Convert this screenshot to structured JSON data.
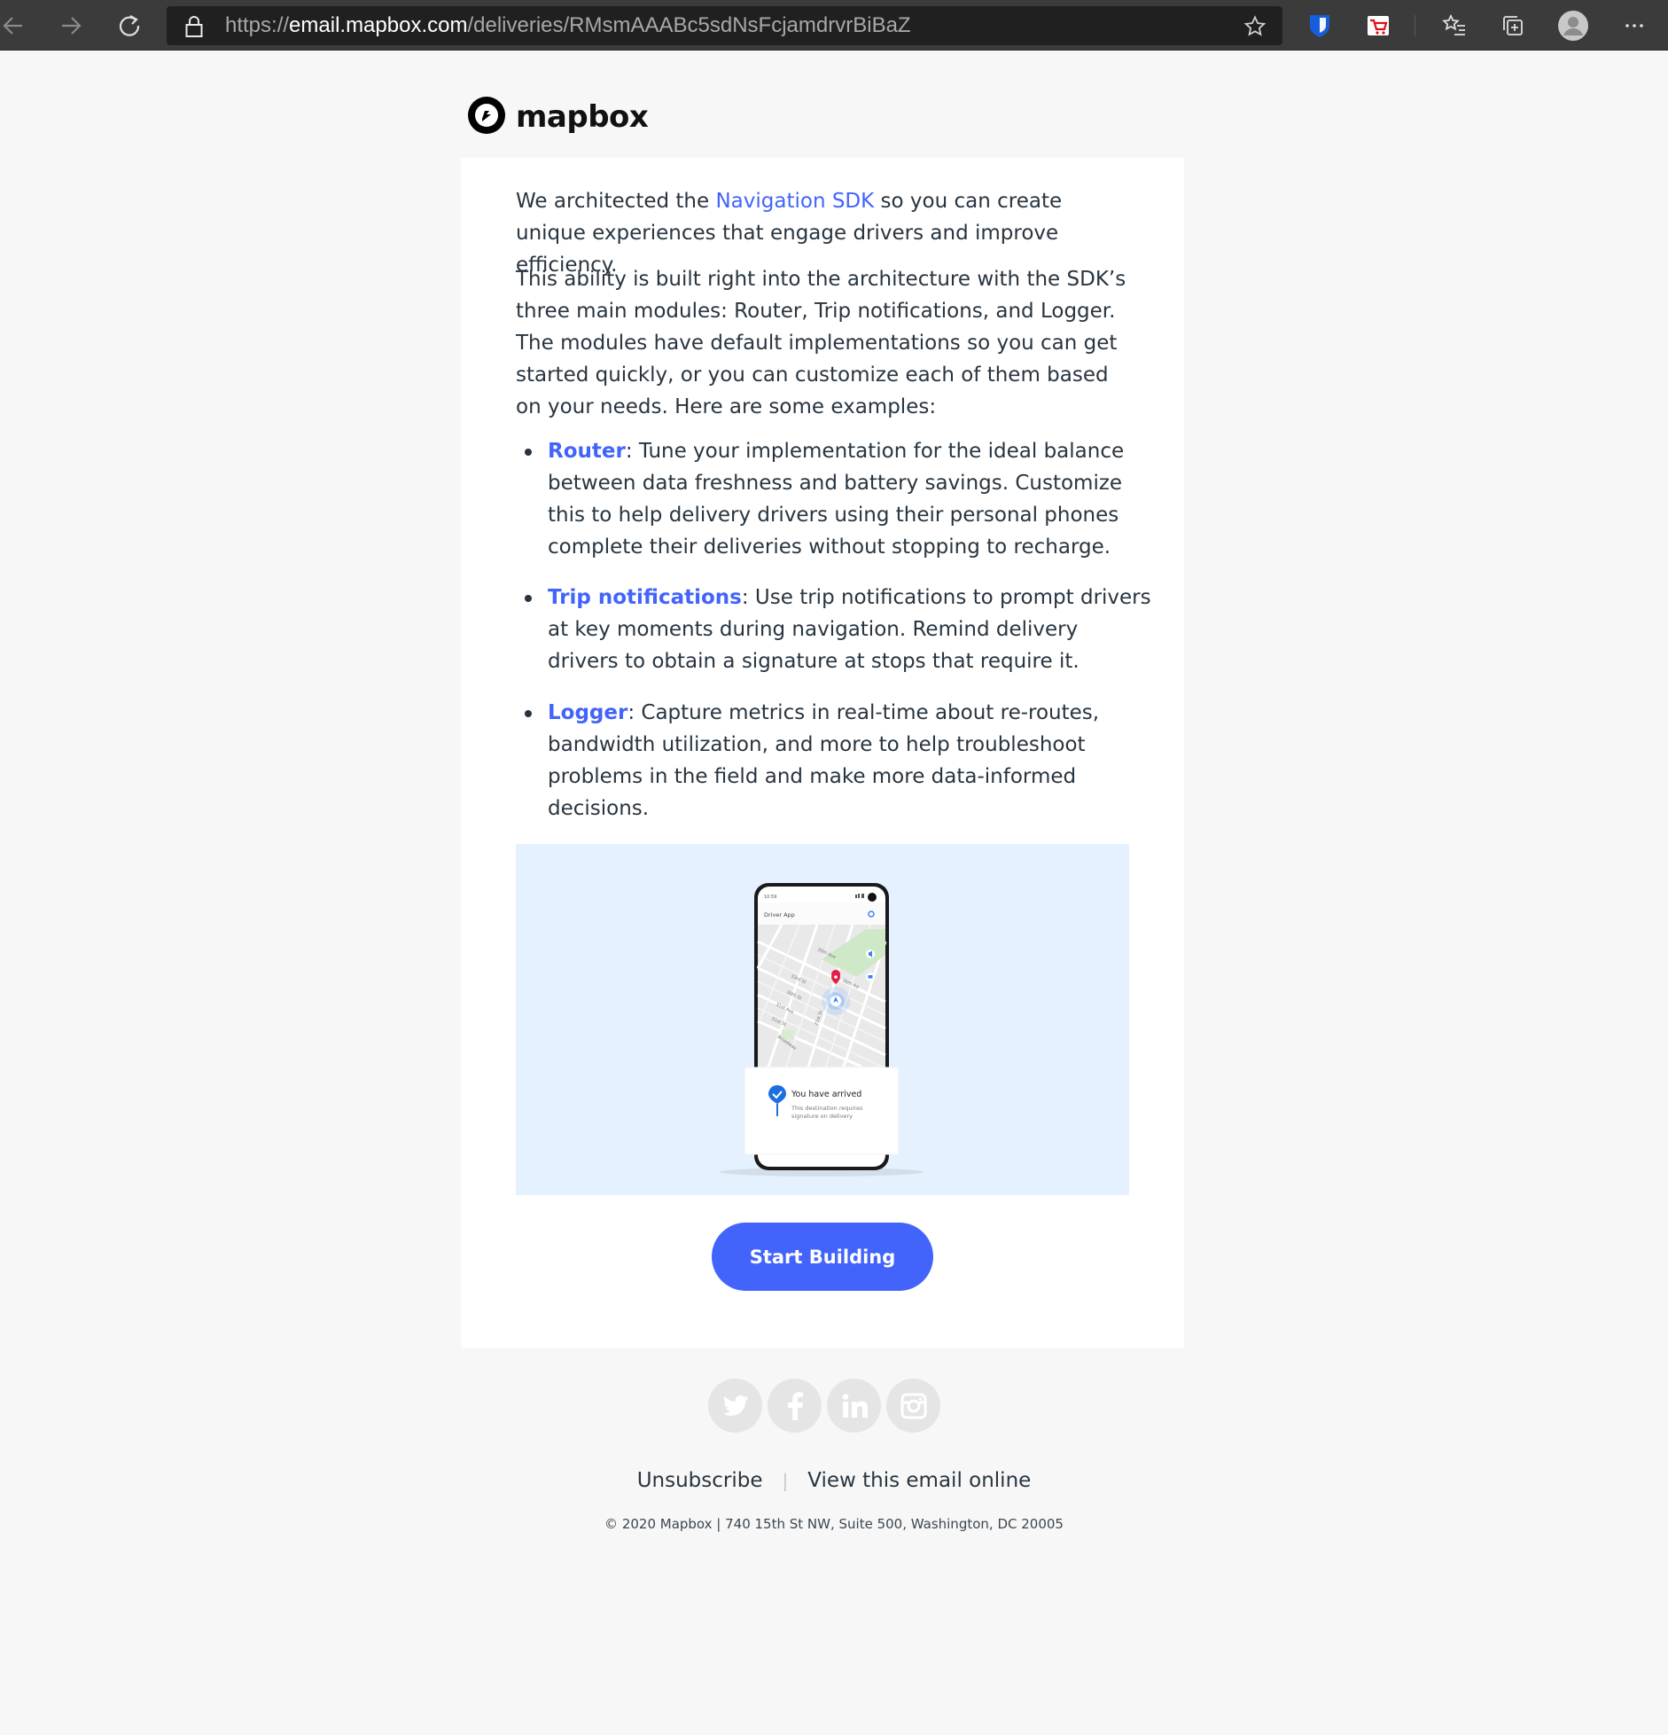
{
  "browser": {
    "url_protocol": "https://",
    "url_host": "email.mapbox.com",
    "url_path": "/deliveries/RMsmAAABc5sdNsFcjamdrvrBiBaZ",
    "icons": [
      "back-arrow-icon",
      "forward-arrow-icon",
      "refresh-icon",
      "lock-icon",
      "favorite-star-icon",
      "bitwarden-shield-icon",
      "extension-icon",
      "favorites-list-icon",
      "collections-icon",
      "profile-avatar-icon",
      "more-menu-icon"
    ]
  },
  "email": {
    "brand_name": "mapbox",
    "intro_before_link": "We architected the ",
    "intro_link": "Navigation SDK",
    "intro_after_link": " so you can create unique experiences that engage drivers and improve efficiency.",
    "paragraph2": "This ability is built right into the architecture with the SDK’s three main modules: Router, Trip notifications, and Logger. The modules have default implementations so you can get started quickly, or you can customize each of them based on your needs. Here are some examples:",
    "bullets": [
      {
        "term": "Router",
        "text": ": Tune your implementation for the ideal balance between data freshness and battery savings. Customize this to help delivery drivers using their personal phones complete their deliveries without stopping to recharge."
      },
      {
        "term": "Trip notifications",
        "text": ": Use trip notifications to prompt drivers at key moments during navigation. Remind delivery drivers to obtain a signature at stops that require it."
      },
      {
        "term": "Logger",
        "text": ": Capture metrics in real-time about re-routes, bandwidth utilization, and more to help troubleshoot problems in the field and make more data-informed decisions."
      }
    ],
    "illustration": {
      "phone_time": "10:59",
      "app_title": "Driver App",
      "street_labels": [
        "35th Ave",
        "33rd St",
        "30th St",
        "36th Rd",
        "31st Ave",
        "31st St",
        "Broadway",
        "21st St"
      ],
      "notification_title": "You have arrived",
      "notification_body_line1": "This destination requires",
      "notification_body_line2": "signature on delivery"
    },
    "cta_label": "Start Building",
    "social_icons": [
      "twitter-icon",
      "facebook-icon",
      "linkedin-icon",
      "instagram-icon"
    ],
    "footer": {
      "unsubscribe": "Unsubscribe",
      "separator": "|",
      "view_online": "View this email online",
      "copyright": "© 2020 Mapbox | 740 15th St NW, Suite 500, Washington, DC 20005"
    },
    "colors": {
      "accent": "#4264fb",
      "hero_background": "#e6f1ff",
      "page_background": "#f7f7f7",
      "text": "#283540"
    }
  }
}
